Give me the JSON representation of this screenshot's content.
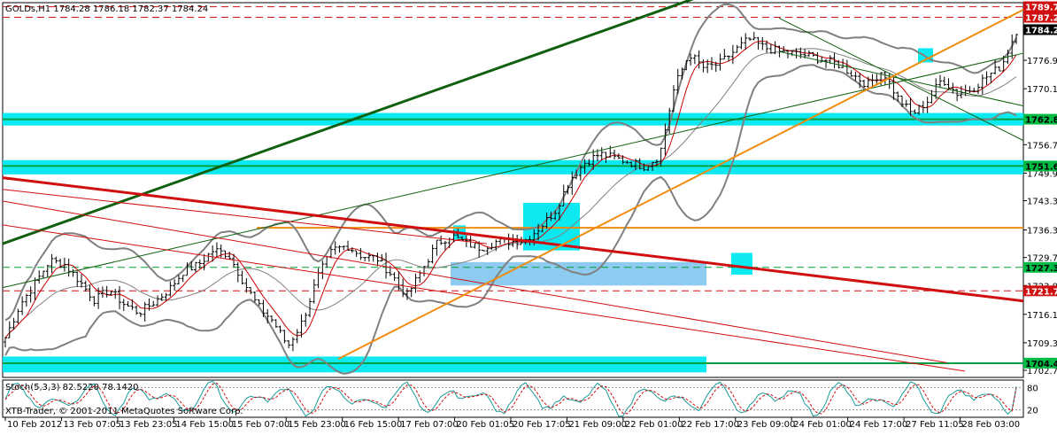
{
  "chart_data": {
    "type": "candlestick",
    "header": {
      "symbol_label": "GOLDs,H1",
      "ohlc_text": "1784.28 1786.18 1782.37 1784.24"
    },
    "price_axis": {
      "ticks": [
        "1776.90",
        "1770.10",
        "1756.70",
        "1749.90",
        "1743.30",
        "1736.30",
        "1729.70",
        "1723.00",
        "1716.10",
        "1709.30",
        "1702.70"
      ],
      "ylim": [
        1701.0,
        1790.7
      ]
    },
    "price_tags": [
      {
        "label": "1789.73",
        "value": 1789.73,
        "color": "#d01010",
        "text_color": "#ffffff"
      },
      {
        "label": "1787.20",
        "value": 1787.2,
        "color": "#d01010",
        "text_color": "#ffffff"
      },
      {
        "label": "1784.24",
        "value": 1784.24,
        "color": "#000000",
        "text_color": "#ffffff"
      },
      {
        "label": "1762.80",
        "value": 1762.8,
        "color": "#00bb44",
        "text_color": "#000000"
      },
      {
        "label": "1751.60",
        "value": 1751.6,
        "color": "#00bb44",
        "text_color": "#000000"
      },
      {
        "label": "1727.34",
        "value": 1727.34,
        "color": "#00bb44",
        "text_color": "#000000"
      },
      {
        "label": "1721.72",
        "value": 1721.72,
        "color": "#d01010",
        "text_color": "#ffffff"
      },
      {
        "label": "1704.43",
        "value": 1704.43,
        "color": "#00bb44",
        "text_color": "#000000"
      }
    ],
    "x_axis": {
      "labels": [
        "10 Feb 2012",
        "13 Feb 07:05",
        "13 Feb 23:05",
        "14 Feb 15:00",
        "15 Feb 07:00",
        "15 Feb 23:00",
        "16 Feb 15:00",
        "17 Feb 07:00",
        "20 Feb 01:05",
        "20 Feb 17:05",
        "21 Feb 09:00",
        "22 Feb 01:00",
        "22 Feb 17:00",
        "23 Feb 09:00",
        "24 Feb 01:00",
        "24 Feb 17:00",
        "27 Feb 11:05",
        "28 Feb 03:00"
      ]
    },
    "price_path": [
      1710.5,
      1718.5,
      1723.5,
      1729.0,
      1728.0,
      1724.0,
      1719.5,
      1722.0,
      1718.5,
      1716.5,
      1719.0,
      1722.0,
      1726.5,
      1728.0,
      1731.5,
      1730.5,
      1724.0,
      1718.0,
      1714.5,
      1708.5,
      1714.5,
      1725.0,
      1731.5,
      1732.5,
      1730.0,
      1729.5,
      1725.5,
      1720.5,
      1726.5,
      1733.0,
      1735.0,
      1733.0,
      1732.0,
      1733.5,
      1733.5,
      1734.0,
      1737.0,
      1741.0,
      1748.5,
      1752.5,
      1754.5,
      1753.5,
      1752.5,
      1751.5,
      1754.0,
      1770.5,
      1778.5,
      1775.0,
      1776.0,
      1779.0,
      1782.0,
      1780.0,
      1779.0,
      1778.5,
      1778.0,
      1777.0,
      1776.0,
      1773.5,
      1771.0,
      1774.5,
      1768.0,
      1764.0,
      1767.0,
      1772.5,
      1769.0,
      1770.0,
      1773.0,
      1775.5,
      1784.0
    ],
    "overlays": {
      "cyan_bands": [
        1762.8,
        1751.6,
        1704.4
      ],
      "orange_horizontal": 1736.8,
      "dashed_levels": [
        {
          "value": 1789.73,
          "color": "#d01010"
        },
        {
          "value": 1787.2,
          "color": "#d01010"
        },
        {
          "value": 1727.34,
          "color": "#00a030"
        },
        {
          "value": 1721.72,
          "color": "#d01010"
        },
        {
          "value": 1704.43,
          "color": "#00a030"
        }
      ]
    },
    "indicator": {
      "label": "Stoch(5,3,3) 82.5220 78.1420",
      "values": [
        82.522,
        78.142
      ],
      "levels": {
        "top": "80",
        "bottom": "20"
      }
    },
    "watermark": "XTB-Trader, © 2001-2011 MetaQuotes Software Corp.",
    "colors": {
      "up_down_bars": "#000000",
      "bollinger": "#808080",
      "trend_red": "#d01010",
      "trend_green": "#106010",
      "trend_orange": "#f08c10",
      "zone_cyan": "#00e8f0",
      "zone_blue": "#88c8f0",
      "ma_red": "#cc0000"
    }
  }
}
